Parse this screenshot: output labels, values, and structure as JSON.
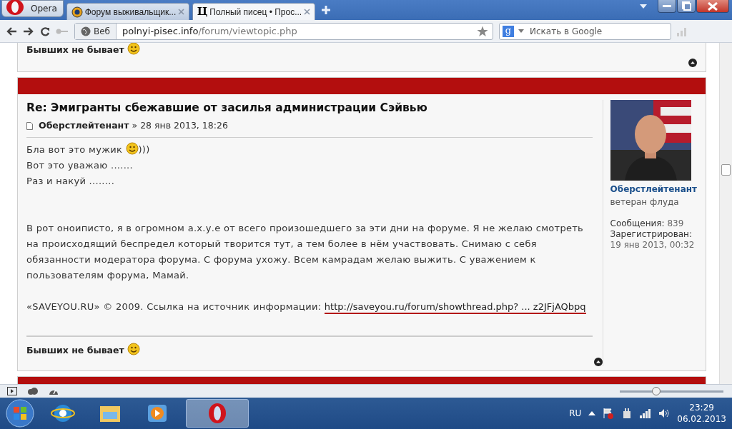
{
  "browser": {
    "menu_button": "Opera",
    "tabs": [
      {
        "label": "Форум выживальщик...",
        "selected": false
      },
      {
        "label": "Полный писец • Прос...",
        "selected": true,
        "icon_text": "Ц"
      }
    ],
    "address": {
      "badge": "Веб",
      "host": "polnyi-pisec.info",
      "path": "/forum/viewtopic.php"
    },
    "search": {
      "engine_icon_text": "g",
      "placeholder": "Искать в Google"
    }
  },
  "prev_post": {
    "signature": "Бывших не бывает"
  },
  "post": {
    "title": "Re: Эмигранты сбежавшие от засилья администрации Сэйвью",
    "author": "Оберстлейтенант",
    "sep": "»",
    "date": "28 янв 2013, 18:26",
    "paragraphs": [
      {
        "parts": [
          {
            "kind": "text",
            "text": "Бла вот это мужик "
          },
          {
            "kind": "smiley"
          },
          {
            "kind": "text",
            "text": ")))"
          }
        ]
      },
      {
        "parts": [
          {
            "kind": "text",
            "text": "Вот это уважаю ......."
          }
        ]
      },
      {
        "parts": [
          {
            "kind": "text",
            "text": "Раз и накуй ........"
          }
        ]
      },
      {
        "gap_before": true,
        "parts": [
          {
            "kind": "text",
            "text": "В рот оноиписто, я в огромном а.х.у.е от всего произошедшего за эти дни на форуме. Я не желаю смотреть на происходящий беспредел который творится тут, а тем более в нём участвовать. Снимаю с себя обязанности модератора форума. С форума ухожу. Всем камрадам желаю выжить. С уважением к пользователям форума, Мамай."
          }
        ]
      },
      {
        "parts": [
          {
            "kind": "text",
            "text": "«SAVEYOU.RU» © 2009. Ссылка на источник информации: "
          },
          {
            "kind": "link",
            "text": "http://saveyou.ru/forum/showthread.php? ... z2JFjAQbpq"
          }
        ]
      }
    ],
    "signature": "Бывших не бывает",
    "profile": {
      "name": "Оберстлейтенант",
      "rank": "ветеран флуда",
      "stats": [
        {
          "label": "Сообщения:",
          "value": "839"
        },
        {
          "label": "Зарегистрирован:",
          "value": "19 янв 2013, 00:32"
        }
      ]
    }
  },
  "status_bar": {
    "zoom": {
      "level": 0.35
    }
  },
  "taskbar": {
    "language": "RU",
    "time": "23:29",
    "date": "06.02.2013"
  }
}
